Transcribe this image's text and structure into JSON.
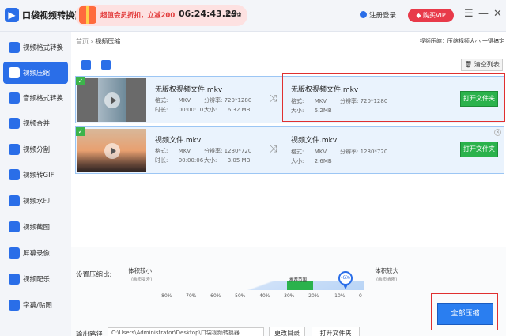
{
  "app": {
    "title": "口袋视频转换器"
  },
  "promo": {
    "text": "超值会员折扣，立减200",
    "countdown": "06:24:43.29",
    "suffix": "后结束"
  },
  "header": {
    "login_label": "注册登录",
    "vip_label": "购买VIP",
    "menu_glyph": "☰",
    "minimize_glyph": "—",
    "close_glyph": "✕"
  },
  "sidebar": {
    "items": [
      {
        "label": "视频格式转换",
        "icon": "video-convert-icon"
      },
      {
        "label": "视频压缩",
        "icon": "video-compress-icon",
        "active": true
      },
      {
        "label": "音频格式转换",
        "icon": "audio-convert-icon"
      },
      {
        "label": "视频合并",
        "icon": "video-merge-icon"
      },
      {
        "label": "视频分割",
        "icon": "video-split-icon"
      },
      {
        "label": "视频转GIF",
        "icon": "gif-icon"
      },
      {
        "label": "视频水印",
        "icon": "watermark-icon"
      },
      {
        "label": "视频截图",
        "icon": "screenshot-icon"
      },
      {
        "label": "屏幕录像",
        "icon": "screen-record-icon"
      },
      {
        "label": "视频配乐",
        "icon": "music-icon"
      },
      {
        "label": "字幕/贴图",
        "icon": "subtitle-icon"
      }
    ]
  },
  "breadcrumb": {
    "home": "首页",
    "sep": "›",
    "current": "视频压缩"
  },
  "hint": "视频压缩：压缩视频大小 一键搞定",
  "toolbar": {
    "clear_label": "清空列表"
  },
  "files": [
    {
      "source": {
        "name": "无版权视频文件.mkv",
        "format_label": "格式:",
        "format": "MKV",
        "res_label": "分辨率:",
        "resolution": "720*1280",
        "duration_label": "时长:",
        "duration": "00:00:10",
        "size_label": "大小:",
        "size": "6.32 MB"
      },
      "output": {
        "name": "无版权视频文件.mkv",
        "format_label": "格式:",
        "format": "MKV",
        "res_label": "分辨率:",
        "resolution": "720*1280",
        "size_label": "大小:",
        "size": "5.2MB"
      },
      "open_label": "打开文件夹"
    },
    {
      "source": {
        "name": "视频文件.mkv",
        "format_label": "格式:",
        "format": "MKV",
        "res_label": "分辨率:",
        "resolution": "1280*720",
        "duration_label": "时长:",
        "duration": "00:00:06",
        "size_label": "大小:",
        "size": "3.05 MB"
      },
      "output": {
        "name": "视频文件.mkv",
        "format_label": "格式:",
        "format": "MKV",
        "res_label": "分辨率:",
        "resolution": "1280*720",
        "size_label": "大小:",
        "size": "2.6MB"
      },
      "open_label": "打开文件夹"
    }
  ],
  "compression": {
    "label": "设置压缩比:",
    "left_title": "体积较小",
    "left_sub": "(画质变差)",
    "right_title": "体积较大",
    "right_sub": "(画质清晰)",
    "recommend": "推荐范围",
    "value_label": "-6%",
    "value": -6,
    "ticks": [
      "-80%",
      "-70%",
      "-60%",
      "-50%",
      "-40%",
      "-30%",
      "-20%",
      "-10%",
      "0"
    ]
  },
  "output": {
    "label": "输出路径:",
    "path": "C:\\Users\\Administrator\\Desktop\\口袋视频转换器",
    "change_label": "更改目录",
    "open_label": "打开文件夹"
  },
  "compress_all_label": "全部压缩"
}
